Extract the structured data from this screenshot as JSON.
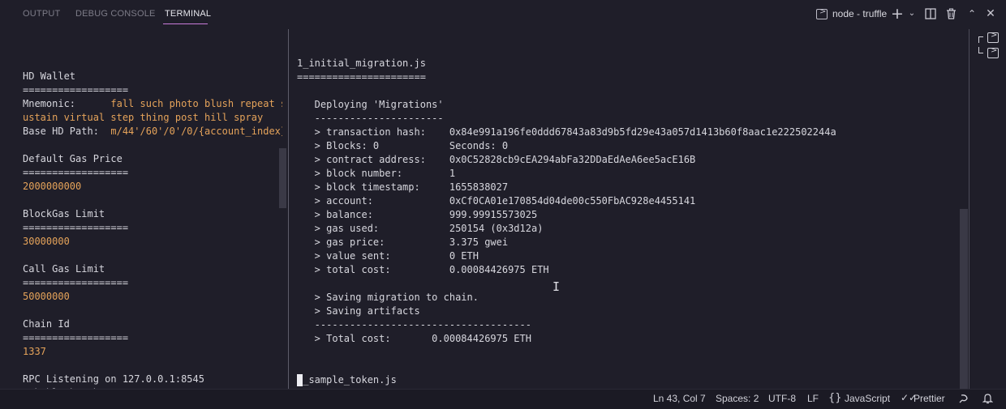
{
  "tabs": [
    "OUTPUT",
    "DEBUG CONSOLE",
    "TERMINAL"
  ],
  "active_tab": "TERMINAL",
  "terminal_name": "node - truffle",
  "toolbar_icons": [
    "terminal-icon",
    "add-icon",
    "chevron-down-icon",
    "split-icon",
    "trash-icon",
    "chevron-up-icon",
    "close-icon"
  ],
  "left_pane": [
    {
      "t": "HD Wallet"
    },
    {
      "t": "=================="
    },
    {
      "t": "Mnemonic:      ",
      "v": "fall such photo blush repeat s"
    },
    {
      "t": "",
      "v": "ustain virtual step thing post hill spray"
    },
    {
      "t": "Base HD Path:  ",
      "v": "m/44'/60'/0'/0/{account_index}"
    },
    {
      "t": ""
    },
    {
      "t": "Default Gas Price"
    },
    {
      "t": "=================="
    },
    {
      "t": "",
      "v": "2000000000"
    },
    {
      "t": ""
    },
    {
      "t": "BlockGas Limit"
    },
    {
      "t": "=================="
    },
    {
      "t": "",
      "v": "30000000"
    },
    {
      "t": ""
    },
    {
      "t": "Call Gas Limit"
    },
    {
      "t": "=================="
    },
    {
      "t": "",
      "v": "50000000"
    },
    {
      "t": ""
    },
    {
      "t": "Chain Id"
    },
    {
      "t": "=================="
    },
    {
      "t": "",
      "v": "1337"
    },
    {
      "t": ""
    },
    {
      "t": "RPC Listening on 127.0.0.1:8545"
    },
    {
      "t": "eth_blockNumber"
    },
    {
      "t": "net_version"
    }
  ],
  "right_pane": [
    "1_initial_migration.js",
    "======================",
    "",
    "   Deploying 'Migrations'",
    "   ----------------------",
    "   > transaction hash:    0x84e991a196fe0ddd67843a83d9b5fd29e43a057d1413b60f8aac1e222502244a",
    "   > Blocks: 0            Seconds: 0",
    "   > contract address:    0x0C52828cb9cEA294abFa32DDaEdAeA6ee5acE16B",
    "   > block number:        1",
    "   > block timestamp:     1655838027",
    "   > account:             0xCf0CA01e170854d04de00c550FbAC928e4455141",
    "   > balance:             999.99915573025",
    "   > gas used:            250154 (0x3d12a)",
    "   > gas price:           3.375 gwei",
    "   > value sent:          0 ETH",
    "   > total cost:          0.00084426975 ETH",
    "",
    "   > Saving migration to chain.",
    "   > Saving artifacts",
    "   -------------------------------------",
    "   > Total cost:       0.00084426975 ETH",
    "",
    "",
    "2_sample_token.js",
    "================="
  ],
  "status": {
    "position": "Ln 43, Col 7",
    "spaces": "Spaces: 2",
    "encoding": "UTF-8",
    "eol": "LF",
    "language": "JavaScript",
    "formatter": "Prettier",
    "language_icon": "braces-icon",
    "formatter_icon": "check-icon",
    "feedback_icon": "feedback-icon",
    "bell_icon": "bell-icon"
  }
}
